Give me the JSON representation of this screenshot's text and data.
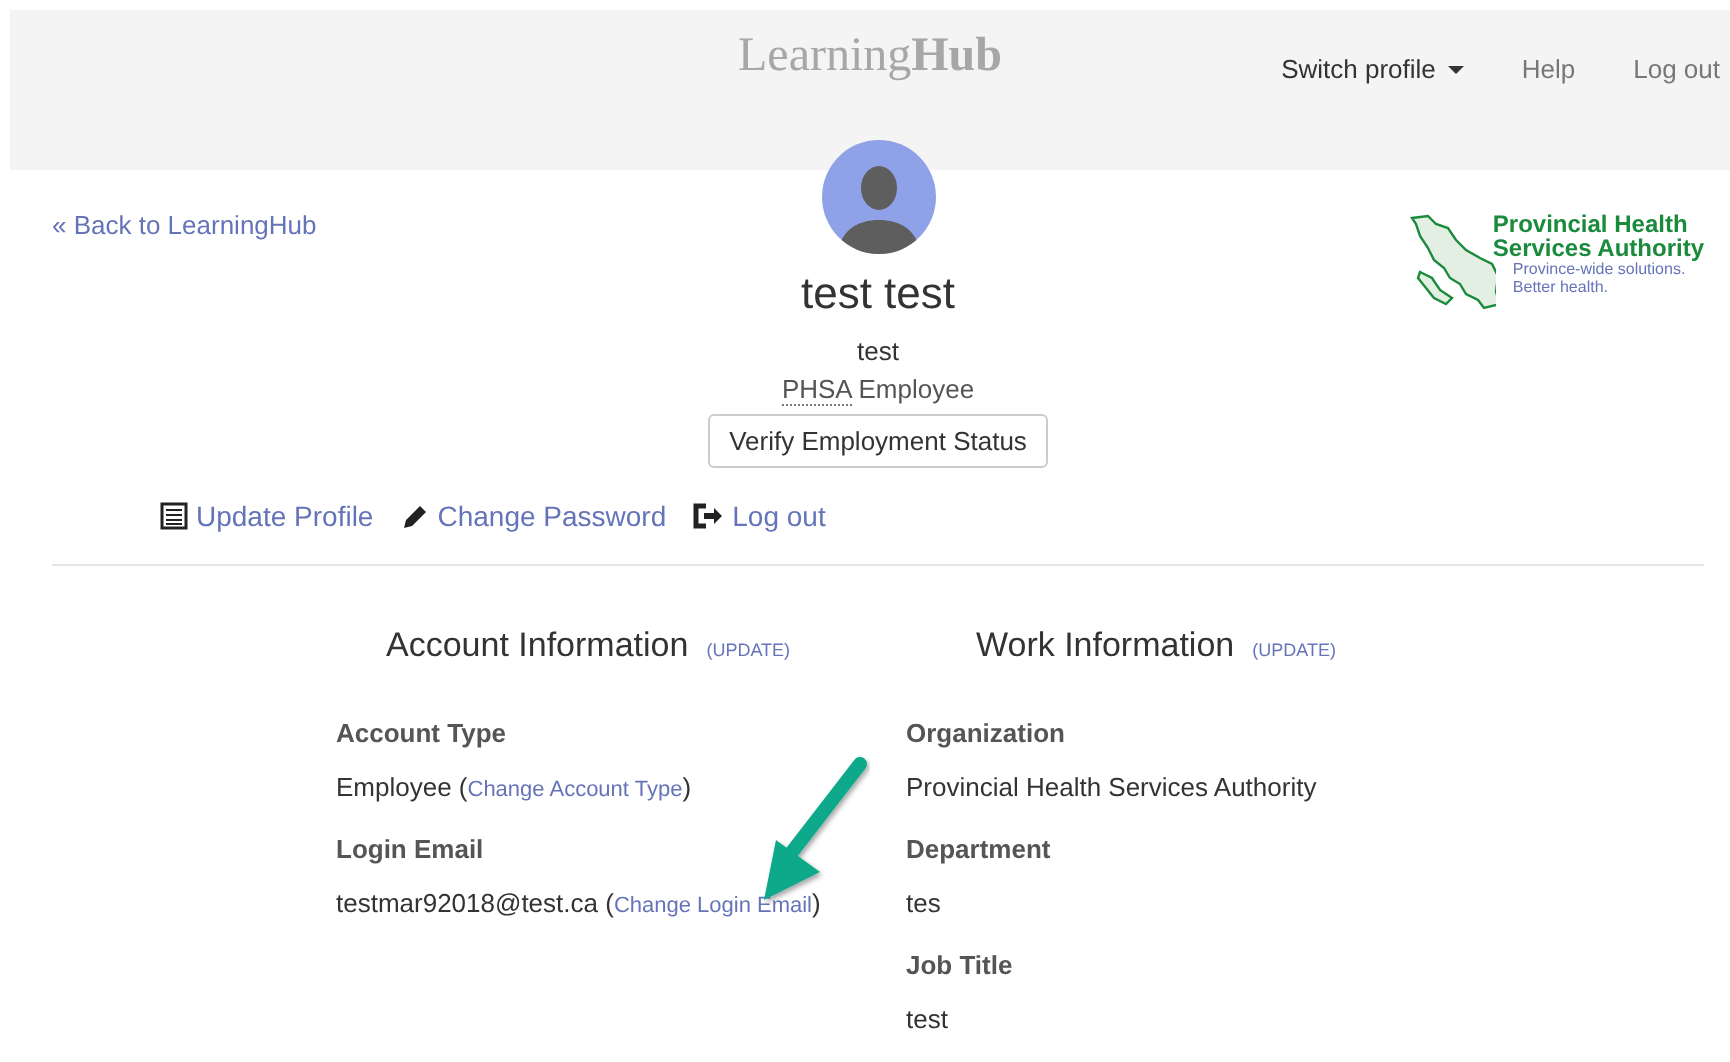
{
  "header": {
    "logo_light": "Learning",
    "logo_bold": "Hub",
    "nav": [
      {
        "label": "Switch profile",
        "kind": "dropdown"
      },
      {
        "label": "Help",
        "kind": "link"
      },
      {
        "label": "Log out",
        "kind": "link"
      }
    ]
  },
  "back_link": "« Back to LearningHub",
  "partner_logo": {
    "name_lines": [
      "Provincial Health",
      "Services Authority"
    ],
    "tagline_lines": [
      "Province-wide solutions.",
      "Better health."
    ]
  },
  "profile": {
    "full_name": "test test",
    "username": "test",
    "org_abbr": "PHSA",
    "role": "Employee",
    "verify_button": "Verify Employment Status",
    "actions": [
      {
        "label": "Update Profile"
      },
      {
        "label": "Change Password"
      },
      {
        "label": "Log out"
      }
    ]
  },
  "sections": [
    {
      "title": "Account Information",
      "update_link": "(UPDATE)",
      "fields": [
        {
          "label": "Account Type",
          "value": "Employee (",
          "action": "Change Account Type",
          "value_end": ")"
        },
        {
          "label": "Login Email",
          "value": "testmar92018@test.ca (",
          "action": "Change Login Email",
          "value_end": ")"
        }
      ]
    },
    {
      "title": "Work Information",
      "update_link": "(UPDATE)",
      "fields": [
        {
          "label": "Organization",
          "value": "Provincial Health Services Authority"
        },
        {
          "label": "Department",
          "value": "tes"
        },
        {
          "label": "Job Title",
          "value": "test"
        }
      ]
    }
  ],
  "annotation": {
    "kind": "arrow",
    "color": "#0aa98a"
  }
}
